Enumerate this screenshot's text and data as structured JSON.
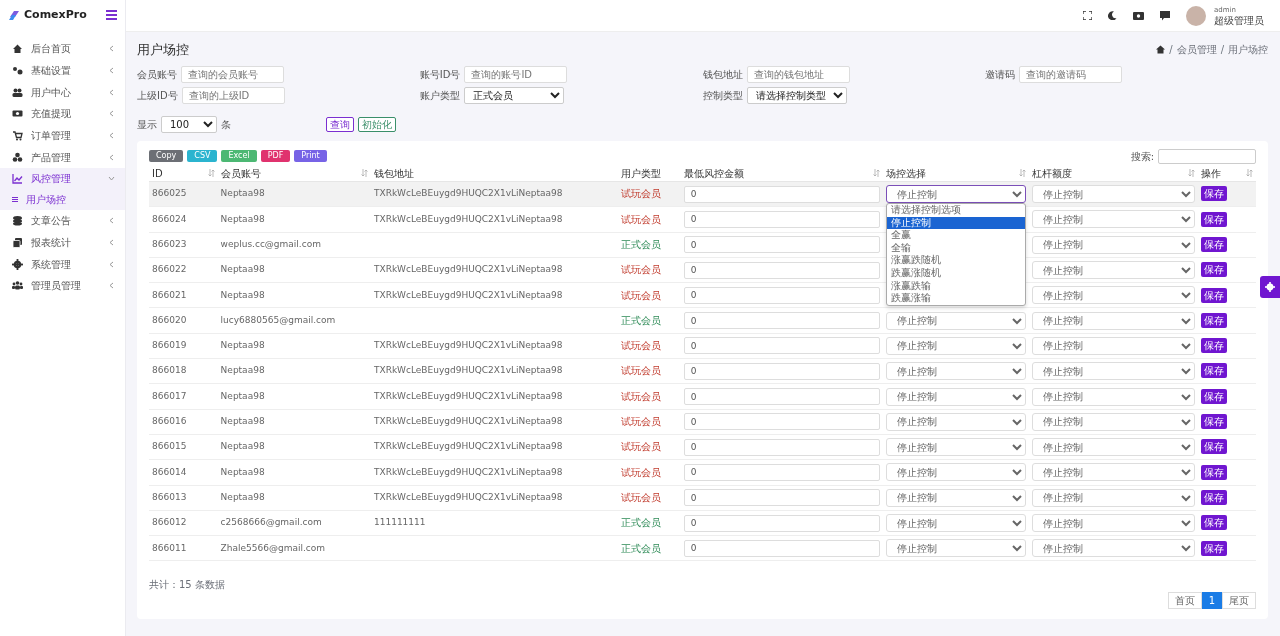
{
  "sidebar": {
    "brand": "ComexPro",
    "items": [
      {
        "label": "后台首页",
        "expanded": false,
        "selected": false
      },
      {
        "label": "基础设置",
        "expanded": false,
        "selected": false
      },
      {
        "label": "用户中心",
        "expanded": false,
        "selected": false
      },
      {
        "label": "充值提现",
        "expanded": false,
        "selected": false
      },
      {
        "label": "订单管理",
        "expanded": false,
        "selected": false
      },
      {
        "label": "产品管理",
        "expanded": false,
        "selected": false
      },
      {
        "label": "风控管理",
        "expanded": true,
        "selected": true,
        "children": [
          {
            "label": "用户场控",
            "selected": true
          }
        ]
      },
      {
        "label": "文章公告",
        "expanded": false,
        "selected": false
      },
      {
        "label": "报表统计",
        "expanded": false,
        "selected": false
      },
      {
        "label": "系统管理",
        "expanded": false,
        "selected": false
      },
      {
        "label": "管理员管理",
        "expanded": false,
        "selected": false
      }
    ]
  },
  "topbar": {
    "user_name": "admin",
    "user_role": "超级管理员"
  },
  "page": {
    "title": "用户场控",
    "breadcrumb": [
      {
        "separator": "/",
        "label": "会员管理"
      },
      {
        "separator": "/",
        "label": "用户场控"
      }
    ]
  },
  "filters": [
    {
      "label": "会员账号",
      "kind": "input",
      "placeholder": "查询的会员账号"
    },
    {
      "label": "账号ID号",
      "kind": "input",
      "placeholder": "查询的账号ID"
    },
    {
      "label": "钱包地址",
      "kind": "input",
      "placeholder": "查询的钱包地址"
    },
    {
      "label": "邀请码",
      "kind": "input",
      "placeholder": "查询的邀请码"
    },
    {
      "label": "上级ID号",
      "kind": "input",
      "placeholder": "查询的上级ID"
    },
    {
      "label": "账户类型",
      "kind": "select",
      "value": "正式会员"
    },
    {
      "label": "控制类型",
      "kind": "select",
      "value": "请选择控制类型"
    }
  ],
  "page_size": {
    "label": "显示",
    "value": "100",
    "unit": "条"
  },
  "actions": [
    {
      "label": "查询",
      "color": "#7b2fd1"
    },
    {
      "label": "初始化",
      "color": "#3a8f6a"
    }
  ],
  "export_buttons": [
    {
      "label": "Copy",
      "color": "#6c6f75"
    },
    {
      "label": "CSV",
      "color": "#2bb4cf"
    },
    {
      "label": "Excel",
      "color": "#4cb873"
    },
    {
      "label": "PDF",
      "color": "#e0326e"
    },
    {
      "label": "Print",
      "color": "#7763e6"
    }
  ],
  "search": {
    "label": "搜索:"
  },
  "table": {
    "columns": [
      {
        "label": "ID",
        "sortable": true
      },
      {
        "label": "会员账号",
        "sortable": true
      },
      {
        "label": "钱包地址",
        "sortable": false
      },
      {
        "label": "用户类型",
        "sortable": false
      },
      {
        "label": "最低风控金额",
        "sortable": true
      },
      {
        "label": "场控选择",
        "sortable": true
      },
      {
        "label": "杠杆额度",
        "sortable": true
      },
      {
        "label": "操作",
        "sortable": true
      }
    ],
    "rows": [
      {
        "id": "866025",
        "account": "Neptaa98",
        "wallet": "TXRkWcLeBEuygd9HUQC2X1vLiNeptaa98",
        "user_type": "试玩会员",
        "kind": "trial",
        "min_amount": "0",
        "control": "停止控制",
        "control_open": true,
        "leverage": "停止控制",
        "action": "保存",
        "selected": true
      },
      {
        "id": "866024",
        "account": "Neptaa98",
        "wallet": "TXRkWcLeBEuygd9HUQC2X1vLiNeptaa98",
        "user_type": "试玩会员",
        "kind": "trial",
        "min_amount": "0",
        "leverage": "停止控制",
        "action": "保存",
        "selected": false
      },
      {
        "id": "866023",
        "account": "weplus.cc@gmail.com",
        "user_type": "正式会员",
        "kind": "formal",
        "min_amount": "0",
        "leverage": "停止控制",
        "action": "保存",
        "selected": false
      },
      {
        "id": "866022",
        "account": "Neptaa98",
        "wallet": "TXRkWcLeBEuygd9HUQC2X1vLiNeptaa98",
        "user_type": "试玩会员",
        "kind": "trial",
        "min_amount": "0",
        "leverage": "停止控制",
        "action": "保存",
        "selected": false
      },
      {
        "id": "866021",
        "account": "Neptaa98",
        "wallet": "TXRkWcLeBEuygd9HUQC2X1vLiNeptaa98",
        "user_type": "试玩会员",
        "kind": "trial",
        "min_amount": "0",
        "leverage": "停止控制",
        "action": "保存",
        "selected": false
      },
      {
        "id": "866020",
        "account": "lucy6880565@gmail.com",
        "user_type": "正式会员",
        "kind": "formal",
        "min_amount": "0",
        "control": "停止控制",
        "leverage": "停止控制",
        "action": "保存",
        "selected": false
      },
      {
        "id": "866019",
        "account": "Neptaa98",
        "wallet": "TXRkWcLeBEuygd9HUQC2X1vLiNeptaa98",
        "user_type": "试玩会员",
        "kind": "trial",
        "min_amount": "0",
        "control": "停止控制",
        "leverage": "停止控制",
        "action": "保存",
        "selected": false
      },
      {
        "id": "866018",
        "account": "Neptaa98",
        "wallet": "TXRkWcLeBEuygd9HUQC2X1vLiNeptaa98",
        "user_type": "试玩会员",
        "kind": "trial",
        "min_amount": "0",
        "control": "停止控制",
        "leverage": "停止控制",
        "action": "保存",
        "selected": false
      },
      {
        "id": "866017",
        "account": "Neptaa98",
        "wallet": "TXRkWcLeBEuygd9HUQC2X1vLiNeptaa98",
        "user_type": "试玩会员",
        "kind": "trial",
        "min_amount": "0",
        "control": "停止控制",
        "leverage": "停止控制",
        "action": "保存",
        "selected": false
      },
      {
        "id": "866016",
        "account": "Neptaa98",
        "wallet": "TXRkWcLeBEuygd9HUQC2X1vLiNeptaa98",
        "user_type": "试玩会员",
        "kind": "trial",
        "min_amount": "0",
        "control": "停止控制",
        "leverage": "停止控制",
        "action": "保存",
        "selected": false
      },
      {
        "id": "866015",
        "account": "Neptaa98",
        "wallet": "TXRkWcLeBEuygd9HUQC2X1vLiNeptaa98",
        "user_type": "试玩会员",
        "kind": "trial",
        "min_amount": "0",
        "control": "停止控制",
        "leverage": "停止控制",
        "action": "保存",
        "selected": false
      },
      {
        "id": "866014",
        "account": "Neptaa98",
        "wallet": "TXRkWcLeBEuygd9HUQC2X1vLiNeptaa98",
        "user_type": "试玩会员",
        "kind": "trial",
        "min_amount": "0",
        "control": "停止控制",
        "leverage": "停止控制",
        "action": "保存",
        "selected": false
      },
      {
        "id": "866013",
        "account": "Neptaa98",
        "wallet": "TXRkWcLeBEuygd9HUQC2X1vLiNeptaa98",
        "user_type": "试玩会员",
        "kind": "trial",
        "min_amount": "0",
        "control": "停止控制",
        "leverage": "停止控制",
        "action": "保存",
        "selected": false
      },
      {
        "id": "866012",
        "account": "c2568666@gmail.com",
        "wallet": "111111111",
        "user_type": "正式会员",
        "kind": "formal",
        "min_amount": "0",
        "control": "停止控制",
        "leverage": "停止控制",
        "action": "保存",
        "selected": false
      },
      {
        "id": "866011",
        "account": "Zhale5566@gmail.com",
        "user_type": "正式会员",
        "kind": "formal",
        "min_amount": "0",
        "control": "停止控制",
        "leverage": "停止控制",
        "action": "保存",
        "selected": false
      }
    ]
  },
  "control_options": [
    {
      "label": "请选择控制选项",
      "selected": false
    },
    {
      "label": "停止控制",
      "selected": true
    },
    {
      "label": "全赢",
      "selected": false
    },
    {
      "label": "全输",
      "selected": false
    },
    {
      "label": "涨赢跌随机",
      "selected": false
    },
    {
      "label": "跌赢涨随机",
      "selected": false
    },
    {
      "label": "涨赢跌输",
      "selected": false
    },
    {
      "label": "跌赢涨输",
      "selected": false
    }
  ],
  "footer": {
    "total": "共计：15 条数据",
    "pagination": [
      {
        "label": "首页",
        "selected": false
      },
      {
        "label": "1",
        "selected": true
      },
      {
        "label": "尾页",
        "selected": false
      }
    ]
  }
}
